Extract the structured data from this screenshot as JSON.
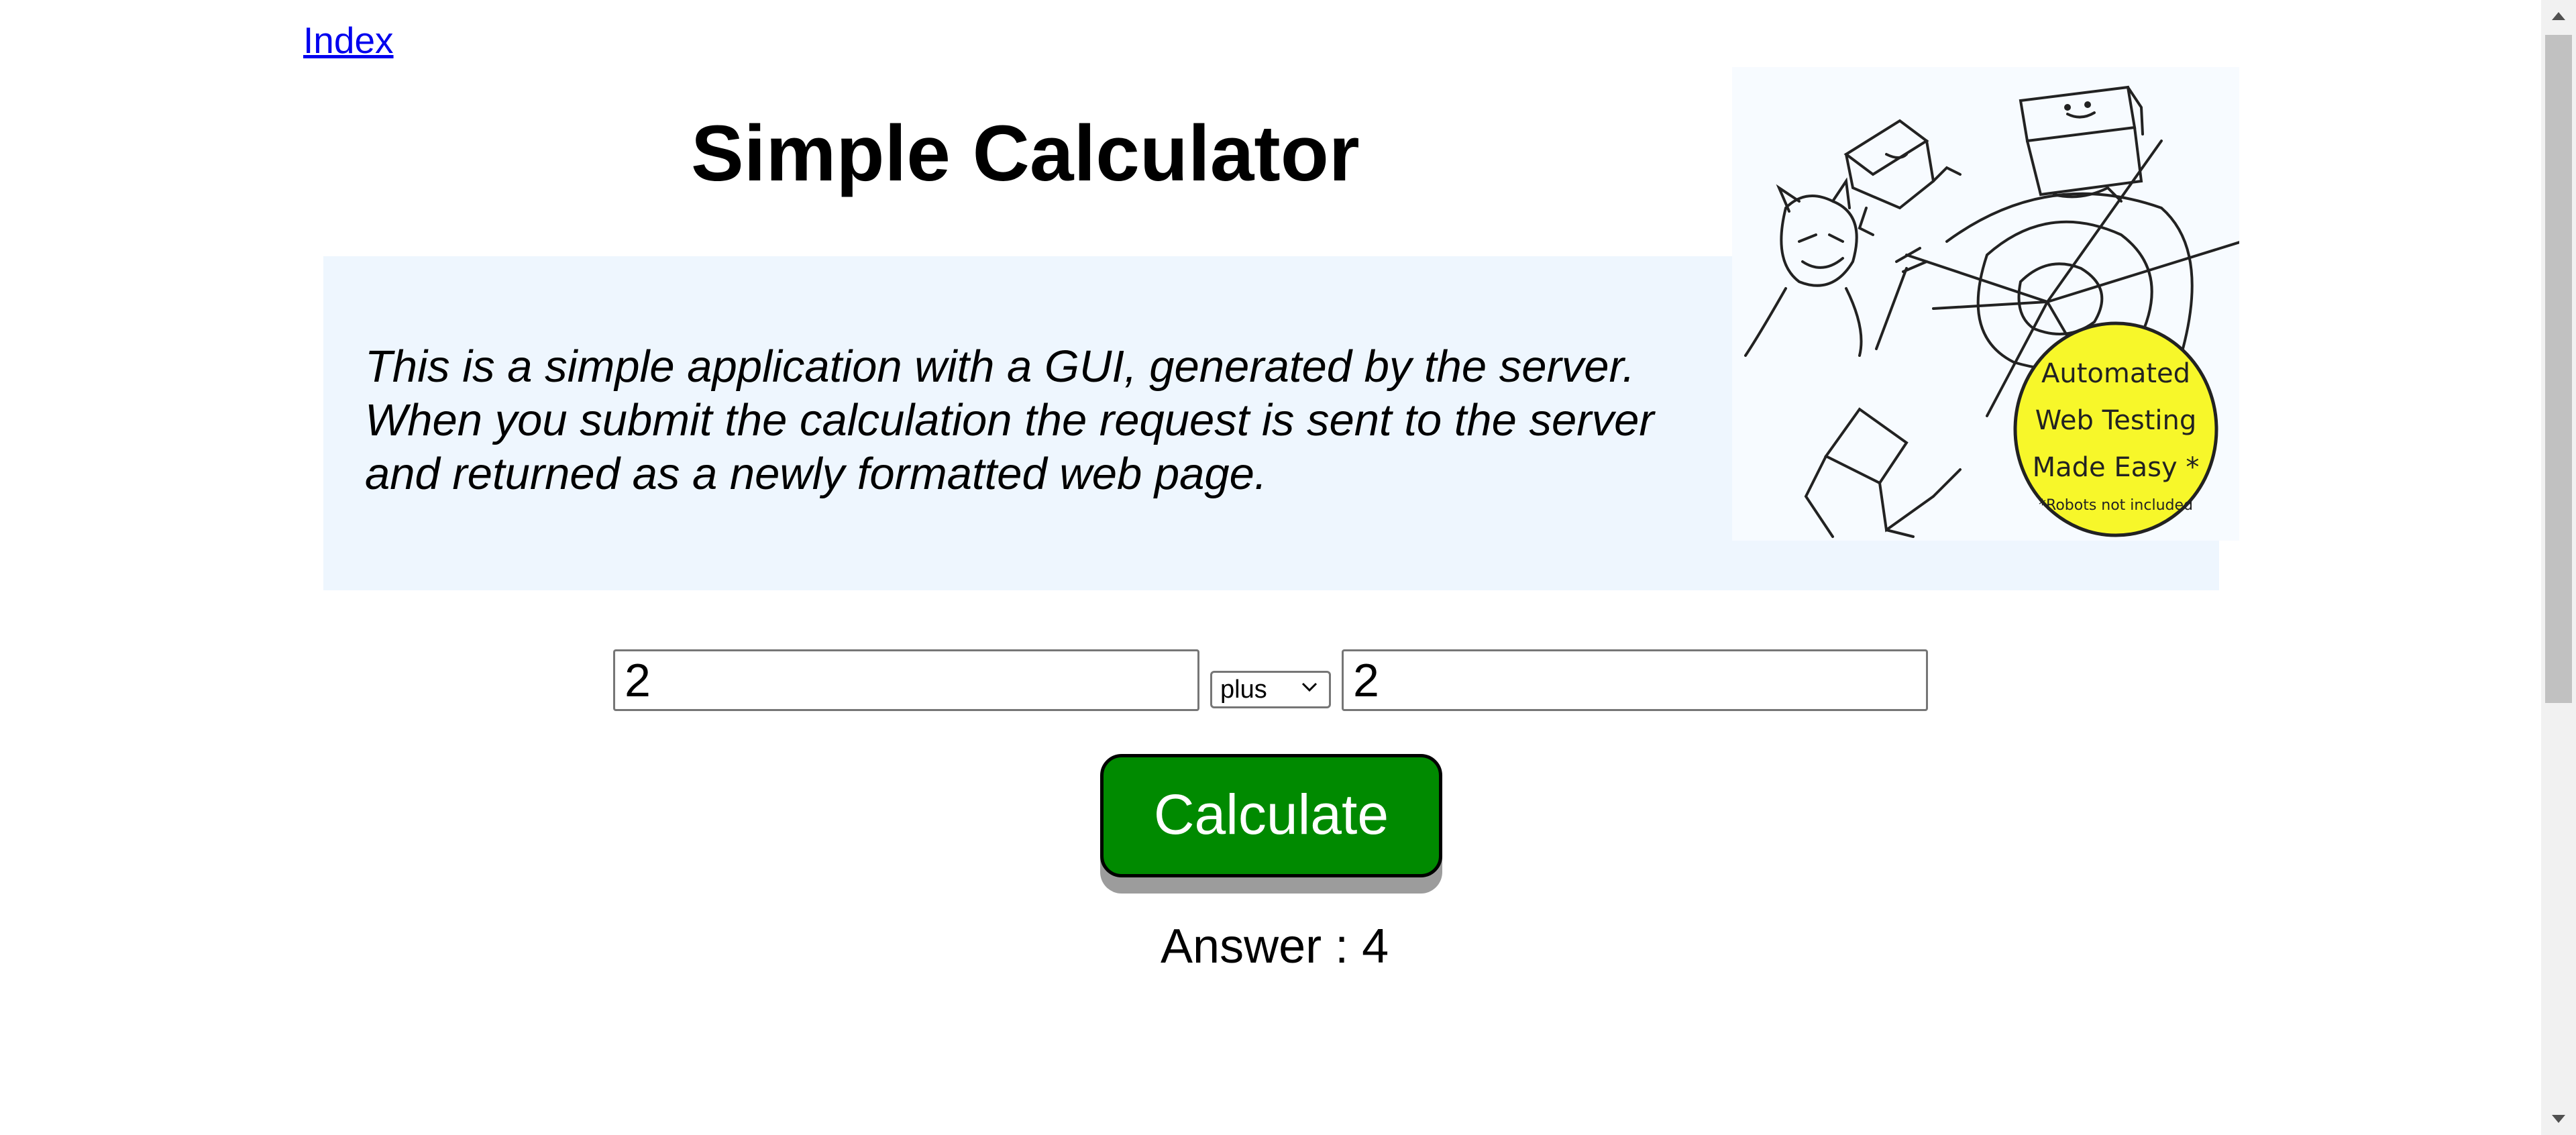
{
  "nav": {
    "index_link": "Index"
  },
  "header": {
    "title": "Simple Calculator"
  },
  "intro": {
    "lines": [
      "This is a simple application with a GUI, generated by the server.",
      "When you submit the calculation the request is sent to the server",
      "and returned as a newly formatted web page."
    ],
    "logo": {
      "icon": "automated-web-testing-logo",
      "text_lines": [
        "Automated",
        "Web Testing",
        "Made Easy *"
      ],
      "footnote": "*Robots not included",
      "badge_color": "#f7f72a"
    }
  },
  "calculator": {
    "first_value": "2",
    "operator": "plus",
    "second_value": "2",
    "button_label": "Calculate",
    "button_color": "#008a00",
    "answer_text": "Answer : 4"
  }
}
